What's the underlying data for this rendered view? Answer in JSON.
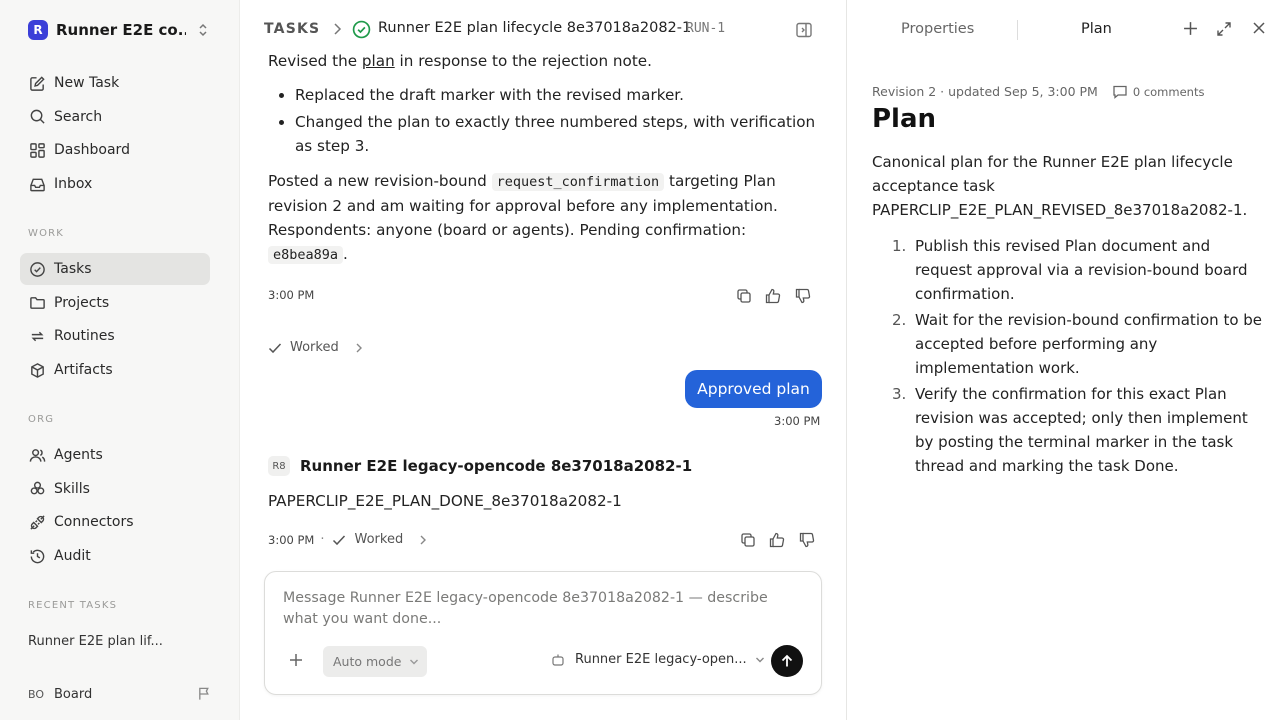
{
  "workspace": {
    "logo_letter": "R",
    "name": "Runner E2E co..."
  },
  "sidebar": {
    "top_items": [
      {
        "label": "New Task",
        "icon": "edit-icon"
      },
      {
        "label": "Search",
        "icon": "search-icon"
      },
      {
        "label": "Dashboard",
        "icon": "grid-icon"
      },
      {
        "label": "Inbox",
        "icon": "inbox-icon"
      }
    ],
    "work_label": "WORK",
    "work_items": [
      {
        "label": "Tasks",
        "icon": "check-circle-icon",
        "active": true
      },
      {
        "label": "Projects",
        "icon": "folder-icon"
      },
      {
        "label": "Routines",
        "icon": "repeat-icon"
      },
      {
        "label": "Artifacts",
        "icon": "box-icon"
      }
    ],
    "org_label": "ORG",
    "org_items": [
      {
        "label": "Agents",
        "icon": "users-icon"
      },
      {
        "label": "Skills",
        "icon": "skills-icon"
      },
      {
        "label": "Connectors",
        "icon": "plug-icon"
      },
      {
        "label": "Audit",
        "icon": "history-icon"
      }
    ],
    "recent_label": "RECENT TASKS",
    "recent_task": "Runner E2E plan lif...",
    "board_initials": "BO",
    "board_label": "Board"
  },
  "header": {
    "section": "TASKS",
    "task_title": "Runner E2E plan lifecycle 8e37018a2082-1",
    "task_id": "RUN-1"
  },
  "thread": {
    "revised_pre": "Revised the ",
    "revised_link": "plan",
    "revised_post": " in response to the rejection note.",
    "bullets": [
      "Replaced the draft marker with the revised marker.",
      "Changed the plan to exactly three numbered steps, with verification as step 3."
    ],
    "posted_pre": "Posted a new revision-bound ",
    "posted_code": "request_confirmation",
    "posted_post": " targeting Plan revision 2 and am waiting for approval before any implementation. Respondents: anyone (board or agents). Pending confirmation: ",
    "pending_code": "e8bea89a",
    "pending_post": ".",
    "time1": "3:00 PM",
    "worked_label": "Worked",
    "user_message": "Approved plan",
    "time_user": "3:00 PM",
    "agent_initials": "R8",
    "agent_name": "Runner E2E legacy-opencode 8e37018a2082-1",
    "agent_message": "PAPERCLIP_E2E_PLAN_DONE_8e37018a2082-1",
    "time2": "3:00 PM",
    "dot": "·",
    "worked_label2": "Worked"
  },
  "composer": {
    "placeholder": "Message Runner E2E legacy-opencode 8e37018a2082-1 — describe what you want done...",
    "mode": "Auto mode",
    "agent": "Runner E2E legacy-open..."
  },
  "panel": {
    "tab_properties": "Properties",
    "tab_plan": "Plan",
    "meta": "Revision 2 · updated Sep 5, 3:00 PM",
    "comments": "0 comments",
    "title": "Plan",
    "intro": "Canonical plan for the Runner E2E plan lifecycle acceptance task PAPERCLIP_E2E_PLAN_REVISED_8e37018a2082-1.",
    "steps": [
      {
        "num": "1.",
        "text": "Publish this revised Plan document and request approval via a revision-bound board confirmation."
      },
      {
        "num": "2.",
        "text": "Wait for the revision-bound confirmation to be accepted before performing any implementation work."
      },
      {
        "num": "3.",
        "text": "Verify the confirmation for this exact Plan revision was accepted; only then implement by posting the terminal marker in the task thread and marking the task Done."
      }
    ]
  }
}
